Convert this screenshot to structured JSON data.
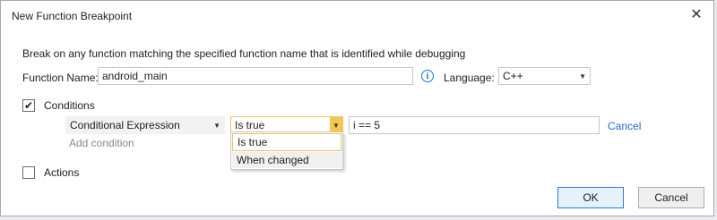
{
  "window": {
    "title": "New Function Breakpoint",
    "close_glyph": "✕"
  },
  "description": "Break on any function matching the specified function name that is identified while debugging",
  "function_name": {
    "label": "Function Name:",
    "value": "android_main"
  },
  "info_icon": "i",
  "language": {
    "label": "Language:",
    "value": "C++"
  },
  "conditions": {
    "label": "Conditions",
    "checked": true,
    "check_glyph": "✔",
    "type_value": "Conditional Expression",
    "operator_value": "Is true",
    "expression_value": "i == 5",
    "cancel_label": "Cancel",
    "add_condition_label": "Add condition",
    "operator_options": [
      "Is true",
      "When changed"
    ]
  },
  "actions": {
    "label": "Actions",
    "checked": false
  },
  "buttons": {
    "ok_label": "OK",
    "cancel_label": "Cancel"
  },
  "colors": {
    "accent": "#1e6dc9",
    "active_combo_arrow": "#f5c94e",
    "default_button_border": "#2f7bd0"
  }
}
